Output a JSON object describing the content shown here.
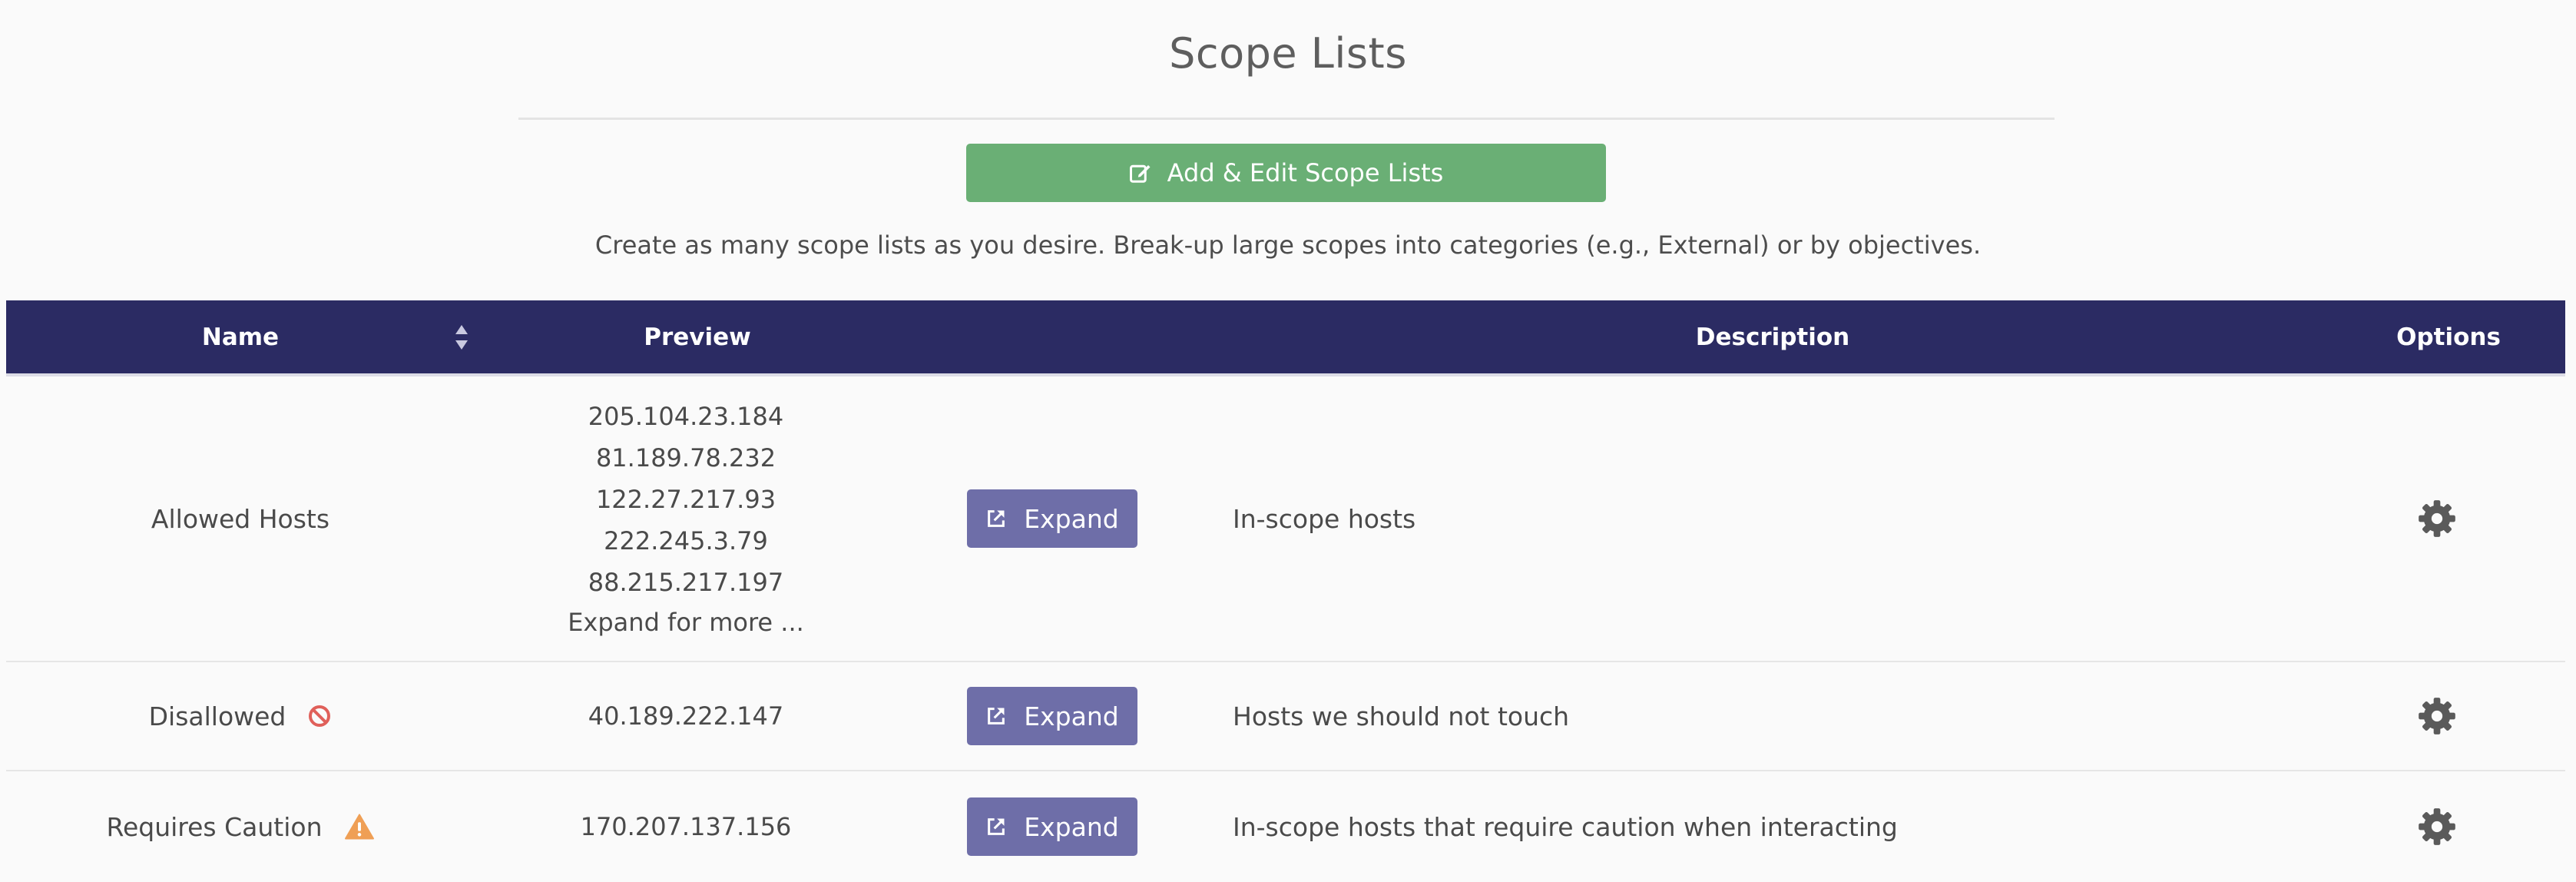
{
  "page": {
    "title": "Scope Lists",
    "add_button_label": "Add & Edit Scope Lists",
    "helper_text": "Create as many scope lists as you desire. Break-up large scopes into categories (e.g., External) or by objectives."
  },
  "table": {
    "headers": {
      "name": "Name",
      "preview": "Preview",
      "description": "Description",
      "options": "Options"
    },
    "rows": [
      {
        "name": "Allowed Hosts",
        "status_icon": "",
        "preview": [
          "205.104.23.184",
          "81.189.78.232",
          "122.27.217.93",
          "222.245.3.79",
          "88.215.217.197"
        ],
        "preview_more": "Expand for more ...",
        "expand_label": "Expand",
        "description": "In-scope hosts"
      },
      {
        "name": "Disallowed",
        "status_icon": "ban-icon",
        "preview": [
          "40.189.222.147"
        ],
        "preview_more": "",
        "expand_label": "Expand",
        "description": "Hosts we should not touch"
      },
      {
        "name": "Requires Caution",
        "status_icon": "warning-icon",
        "preview": [
          "170.207.137.156"
        ],
        "preview_more": "",
        "expand_label": "Expand",
        "description": "In-scope hosts that require caution when interacting"
      }
    ]
  },
  "colors": {
    "background": "#fafafa",
    "header": "#2b2b63",
    "add_button": "#6aaf75",
    "expand_button": "#6e6ea8",
    "ban_icon": "#e0605a",
    "warning_icon": "#ef9f55",
    "gear_icon": "#5a5a5a"
  }
}
